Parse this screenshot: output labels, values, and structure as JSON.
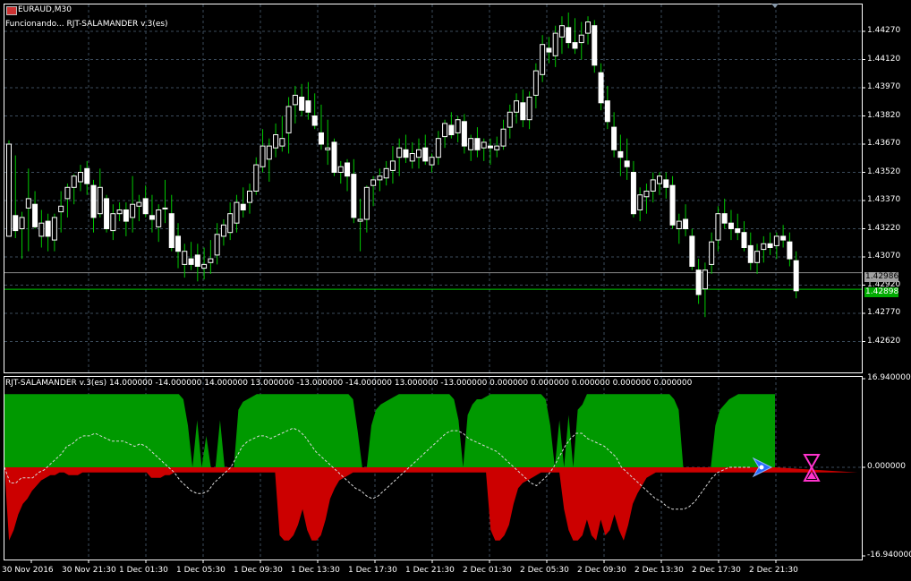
{
  "window": {
    "symbol_title": "EURAUD,M30",
    "status_text": "Funcionando... RJT-SALAMANDER v.3(es)"
  },
  "indicator": {
    "header": "RJT-SALAMANDER v.3(es) 14.000000 -14.000000 14.000000 13.000000 -13.000000 -14.000000 13.000000 -13.000000 0.000000 0.000000 0.000000 0.000000 0.000000"
  },
  "colors": {
    "background": "#000000",
    "grid": "#3c4c5c",
    "bull": "#ffffff",
    "bear": "#ffffff",
    "wick": "#00c800",
    "frame": "#ffffff",
    "green_fill": "#009900",
    "red_fill": "#cc0000",
    "dashed_line": "#d8d8d8",
    "bid_line": "#00cc00",
    "ask_line": "#888888",
    "bid_tag": "#00aa00",
    "ask_tag": "#a0a0a0"
  },
  "price_axis": {
    "labels": [
      "1.44270",
      "1.44120",
      "1.43970",
      "1.43820",
      "1.43670",
      "1.43520",
      "1.43370",
      "1.43220",
      "1.43070",
      "1.42920",
      "1.42770",
      "1.42620"
    ],
    "ask_tag": "1.42986",
    "bid_tag": "1.42898"
  },
  "indicator_axis": {
    "labels": [
      "16.940000",
      "0.000000",
      "-16.940000"
    ]
  },
  "time_axis": {
    "labels": [
      "30 Nov 2016",
      "30 Nov 21:30",
      "1 Dec 01:30",
      "1 Dec 05:30",
      "1 Dec 09:30",
      "1 Dec 13:30",
      "1 Dec 17:30",
      "1 Dec 21:30",
      "2 Dec 01:30",
      "2 Dec 05:30",
      "2 Dec 09:30",
      "2 Dec 13:30",
      "2 Dec 17:30",
      "2 Dec 21:30"
    ]
  },
  "chart_data": {
    "type": "candlestick",
    "symbol": "EURAUD",
    "timeframe": "M30",
    "candles": [
      [
        1.4318,
        1.4369,
        1.4318,
        1.4367
      ],
      [
        1.4329,
        1.4361,
        1.4317,
        1.4321
      ],
      [
        1.4322,
        1.4331,
        1.4306,
        1.4328
      ],
      [
        1.4333,
        1.4354,
        1.431,
        1.4338
      ],
      [
        1.4335,
        1.4342,
        1.4322,
        1.4323
      ],
      [
        1.4318,
        1.4332,
        1.4312,
        1.4325
      ],
      [
        1.4326,
        1.433,
        1.431,
        1.4318
      ],
      [
        1.4316,
        1.433,
        1.431,
        1.4328
      ],
      [
        1.4331,
        1.4342,
        1.432,
        1.4334
      ],
      [
        1.4338,
        1.4346,
        1.4328,
        1.4344
      ],
      [
        1.4344,
        1.4351,
        1.4335,
        1.435
      ],
      [
        1.4347,
        1.4356,
        1.4342,
        1.4352
      ],
      [
        1.4354,
        1.4358,
        1.434,
        1.4346
      ],
      [
        1.4345,
        1.4348,
        1.432,
        1.4328
      ],
      [
        1.433,
        1.4354,
        1.4328,
        1.4344
      ],
      [
        1.4338,
        1.434,
        1.432,
        1.4322
      ],
      [
        1.4321,
        1.4335,
        1.4316,
        1.433
      ],
      [
        1.433,
        1.4336,
        1.4326,
        1.4332
      ],
      [
        1.4332,
        1.4336,
        1.4318,
        1.4326
      ],
      [
        1.4328,
        1.435,
        1.432,
        1.4335
      ],
      [
        1.4334,
        1.434,
        1.4326,
        1.4336
      ],
      [
        1.4338,
        1.4345,
        1.4328,
        1.433
      ],
      [
        1.4329,
        1.434,
        1.432,
        1.4327
      ],
      [
        1.4323,
        1.4335,
        1.4315,
        1.4332
      ],
      [
        1.4333,
        1.4348,
        1.4325,
        1.4333
      ],
      [
        1.433,
        1.434,
        1.431,
        1.4312
      ],
      [
        1.4318,
        1.4325,
        1.4301,
        1.431
      ],
      [
        1.4303,
        1.4314,
        1.4296,
        1.431
      ],
      [
        1.4306,
        1.4315,
        1.43,
        1.4303
      ],
      [
        1.4308,
        1.4314,
        1.4294,
        1.4302
      ],
      [
        1.4301,
        1.4312,
        1.4295,
        1.4303
      ],
      [
        1.4304,
        1.4316,
        1.4298,
        1.4306
      ],
      [
        1.4308,
        1.4325,
        1.4303,
        1.4319
      ],
      [
        1.4318,
        1.4327,
        1.4313,
        1.4324
      ],
      [
        1.432,
        1.4336,
        1.4316,
        1.433
      ],
      [
        1.4325,
        1.434,
        1.432,
        1.4336
      ],
      [
        1.4335,
        1.4344,
        1.4328,
        1.4332
      ],
      [
        1.4336,
        1.4346,
        1.433,
        1.4342
      ],
      [
        1.4342,
        1.436,
        1.434,
        1.4356
      ],
      [
        1.4355,
        1.4375,
        1.4352,
        1.4366
      ],
      [
        1.4359,
        1.437,
        1.4347,
        1.4366
      ],
      [
        1.4365,
        1.4378,
        1.436,
        1.4372
      ],
      [
        1.4366,
        1.4382,
        1.4363,
        1.437
      ],
      [
        1.4373,
        1.4392,
        1.4362,
        1.4387
      ],
      [
        1.4388,
        1.4398,
        1.4378,
        1.4393
      ],
      [
        1.4392,
        1.4399,
        1.4382,
        1.4385
      ],
      [
        1.439,
        1.44,
        1.438,
        1.4384
      ],
      [
        1.4382,
        1.4394,
        1.4375,
        1.4377
      ],
      [
        1.4373,
        1.4388,
        1.4364,
        1.4367
      ],
      [
        1.4364,
        1.438,
        1.4356,
        1.4365
      ],
      [
        1.4368,
        1.437,
        1.435,
        1.4352
      ],
      [
        1.4352,
        1.4358,
        1.4346,
        1.4355
      ],
      [
        1.4357,
        1.4359,
        1.4342,
        1.435
      ],
      [
        1.4351,
        1.4359,
        1.4325,
        1.4328
      ],
      [
        1.4326,
        1.4338,
        1.431,
        1.4327
      ],
      [
        1.4327,
        1.4345,
        1.432,
        1.4344
      ],
      [
        1.4345,
        1.435,
        1.4334,
        1.4348
      ],
      [
        1.4348,
        1.4354,
        1.4342,
        1.435
      ],
      [
        1.4349,
        1.4358,
        1.4345,
        1.4354
      ],
      [
        1.4353,
        1.4366,
        1.4346,
        1.4358
      ],
      [
        1.436,
        1.437,
        1.435,
        1.4365
      ],
      [
        1.4364,
        1.4372,
        1.4357,
        1.436
      ],
      [
        1.4358,
        1.4368,
        1.4354,
        1.4362
      ],
      [
        1.436,
        1.437,
        1.4354,
        1.4364
      ],
      [
        1.4365,
        1.4372,
        1.4356,
        1.4358
      ],
      [
        1.4356,
        1.4362,
        1.4352,
        1.436
      ],
      [
        1.436,
        1.4374,
        1.4356,
        1.437
      ],
      [
        1.4371,
        1.438,
        1.4365,
        1.4378
      ],
      [
        1.4377,
        1.4384,
        1.437,
        1.4372
      ],
      [
        1.4373,
        1.4382,
        1.4368,
        1.438
      ],
      [
        1.4379,
        1.4383,
        1.4362,
        1.4366
      ],
      [
        1.4364,
        1.4372,
        1.4358,
        1.437
      ],
      [
        1.437,
        1.4376,
        1.436,
        1.4364
      ],
      [
        1.4365,
        1.437,
        1.4358,
        1.4368
      ],
      [
        1.4366,
        1.437,
        1.4356,
        1.4365
      ],
      [
        1.4364,
        1.4371,
        1.436,
        1.4366
      ],
      [
        1.4366,
        1.438,
        1.4364,
        1.4375
      ],
      [
        1.4376,
        1.4388,
        1.437,
        1.4384
      ],
      [
        1.4384,
        1.4394,
        1.4378,
        1.439
      ],
      [
        1.4389,
        1.4396,
        1.4376,
        1.438
      ],
      [
        1.438,
        1.4395,
        1.4375,
        1.4392
      ],
      [
        1.4393,
        1.441,
        1.4386,
        1.4406
      ],
      [
        1.4404,
        1.4425,
        1.44,
        1.442
      ],
      [
        1.4418,
        1.4424,
        1.441,
        1.4416
      ],
      [
        1.4414,
        1.443,
        1.4408,
        1.4426
      ],
      [
        1.4424,
        1.4435,
        1.4415,
        1.443
      ],
      [
        1.4429,
        1.4437,
        1.4418,
        1.4421
      ],
      [
        1.4421,
        1.4434,
        1.4415,
        1.4418
      ],
      [
        1.4421,
        1.4432,
        1.4412,
        1.4425
      ],
      [
        1.4426,
        1.4435,
        1.442,
        1.4432
      ],
      [
        1.443,
        1.4433,
        1.4405,
        1.4409
      ],
      [
        1.4405,
        1.441,
        1.4385,
        1.4389
      ],
      [
        1.439,
        1.4398,
        1.4375,
        1.4379
      ],
      [
        1.4376,
        1.4384,
        1.436,
        1.4364
      ],
      [
        1.4363,
        1.4372,
        1.435,
        1.436
      ],
      [
        1.4358,
        1.437,
        1.4348,
        1.4355
      ],
      [
        1.4352,
        1.4358,
        1.4328,
        1.433
      ],
      [
        1.4332,
        1.4344,
        1.4326,
        1.434
      ],
      [
        1.4339,
        1.4346,
        1.433,
        1.4342
      ],
      [
        1.4342,
        1.4352,
        1.4336,
        1.4348
      ],
      [
        1.4346,
        1.4352,
        1.434,
        1.435
      ],
      [
        1.4348,
        1.4352,
        1.4338,
        1.4344
      ],
      [
        1.4345,
        1.435,
        1.4322,
        1.4324
      ],
      [
        1.4322,
        1.433,
        1.4314,
        1.4326
      ],
      [
        1.4327,
        1.4335,
        1.4318,
        1.4322
      ],
      [
        1.4318,
        1.4322,
        1.43,
        1.4302
      ],
      [
        1.43,
        1.4306,
        1.4282,
        1.4287
      ],
      [
        1.429,
        1.4304,
        1.4275,
        1.43
      ],
      [
        1.4303,
        1.432,
        1.4298,
        1.4315
      ],
      [
        1.4316,
        1.4334,
        1.431,
        1.433
      ],
      [
        1.433,
        1.4338,
        1.4322,
        1.4325
      ],
      [
        1.4325,
        1.4332,
        1.4316,
        1.4322
      ],
      [
        1.4322,
        1.433,
        1.4316,
        1.432
      ],
      [
        1.432,
        1.4326,
        1.431,
        1.4312
      ],
      [
        1.4313,
        1.432,
        1.43,
        1.4304
      ],
      [
        1.4304,
        1.4314,
        1.4298,
        1.431
      ],
      [
        1.4311,
        1.4318,
        1.4304,
        1.4314
      ],
      [
        1.4314,
        1.432,
        1.4308,
        1.4312
      ],
      [
        1.4313,
        1.432,
        1.4306,
        1.4318
      ],
      [
        1.4318,
        1.4324,
        1.4312,
        1.4316
      ],
      [
        1.4315,
        1.432,
        1.4302,
        1.4306
      ],
      [
        1.4305,
        1.431,
        1.4285,
        1.4289
      ]
    ],
    "indicator_panel": {
      "name": "RJT-SALAMANDER v.3(es)",
      "ylim": [
        -16.94,
        16.94
      ],
      "series": [
        {
          "values": [
            14,
            14,
            14,
            14,
            14,
            14,
            14,
            14,
            14,
            14,
            14,
            14,
            14,
            14,
            14,
            14,
            14,
            14,
            14,
            14,
            14,
            14,
            14,
            14,
            14,
            14,
            14,
            14,
            14,
            14,
            14,
            14,
            14,
            14,
            14,
            14,
            14,
            14,
            14,
            13,
            8,
            0,
            9,
            0,
            6,
            0,
            0,
            9,
            0,
            0,
            0,
            11,
            12.5,
            13,
            13.5,
            14,
            14,
            14,
            14,
            14,
            14,
            14,
            14,
            14,
            14,
            14,
            14,
            14,
            14,
            14,
            14,
            14,
            14,
            14,
            14,
            14,
            13,
            7,
            0,
            0,
            8,
            11,
            12,
            12.5,
            13,
            13.5,
            14,
            14,
            14,
            14,
            14,
            14,
            14,
            14,
            14,
            14,
            14,
            14,
            13,
            9,
            0,
            10,
            12,
            13,
            13,
            13.5,
            14,
            14,
            14,
            14,
            14,
            14,
            14,
            14,
            14,
            14,
            14,
            14,
            13,
            8,
            0,
            9,
            0,
            10,
            0,
            11,
            12,
            14,
            14,
            14,
            14,
            14,
            14,
            14,
            14,
            14,
            14,
            14,
            14,
            14,
            14,
            14,
            14,
            14,
            14,
            14,
            13,
            11,
            0,
            0,
            0,
            0,
            0,
            0,
            0,
            8,
            11,
            12,
            13,
            13.5,
            14,
            14,
            14,
            14,
            14,
            14,
            14,
            14,
            14
          ]
        },
        {
          "values": [
            0,
            -14,
            -12,
            -9,
            -7,
            -6,
            -4.5,
            -3.5,
            -2.5,
            -2,
            -1.5,
            -1.5,
            -1,
            -1,
            -1.5,
            -1.5,
            -1.5,
            -1,
            -1,
            -1,
            -1,
            -1,
            -1,
            -1,
            -1,
            -1,
            -1,
            -1,
            -1,
            -1,
            -1,
            -1,
            -2,
            -2,
            -2,
            -1.5,
            -1.5,
            -1,
            -1,
            -1,
            -1,
            -1,
            -1,
            -1,
            -1,
            -1,
            -1,
            -1,
            -1,
            -1,
            -1,
            -1,
            -1,
            -1,
            -1,
            -1,
            -1,
            -1,
            -1,
            -1,
            -13,
            -14,
            -14,
            -13,
            -11,
            -8,
            -12,
            -14,
            -14,
            -13,
            -10,
            -6,
            -4,
            -2.5,
            -2,
            -1.5,
            -1,
            -1,
            -1,
            -1,
            -1,
            -1,
            -1,
            -1,
            -1,
            -1,
            -1,
            -1,
            -1,
            -1,
            -1,
            -1,
            -1,
            -1,
            -1,
            -1,
            -1,
            -1,
            -1,
            -1,
            -1,
            -1,
            -1,
            -1,
            -1,
            -1,
            -12,
            -14,
            -14,
            -13,
            -11,
            -7,
            -4,
            -3,
            -2.5,
            -2,
            -1.5,
            -1,
            -1,
            -1,
            -1,
            -1,
            -8,
            -12,
            -14,
            -14,
            -13,
            -10,
            -13,
            -14,
            -10,
            -13,
            -12,
            -9,
            -12,
            -14,
            -11,
            -7,
            -5,
            -3.5,
            -2,
            -1.5,
            -1,
            -1,
            -1,
            -1,
            -1,
            -1,
            -1,
            -1,
            -1,
            -1,
            -1,
            -1,
            -1,
            -1,
            -1,
            -1,
            -1,
            -1,
            -1,
            -1,
            -1,
            -1,
            -1,
            -1,
            -1,
            -1,
            -1,
            -1,
            -1,
            -1,
            -1,
            -1,
            -1,
            -1,
            -1,
            -1,
            -1,
            -1,
            -1,
            -1,
            -1,
            -1,
            -1,
            -1,
            -1
          ]
        },
        {
          "values": [
            0,
            -3,
            -3,
            -2,
            -2,
            -2,
            -1,
            -0.5,
            0.5,
            1.5,
            2.5,
            4,
            4.5,
            5.5,
            6,
            6,
            6.5,
            6,
            5.5,
            5,
            5,
            5,
            4.5,
            4,
            4.5,
            4,
            3,
            2,
            1,
            0,
            -1,
            -2.5,
            -3.5,
            -4.5,
            -5,
            -5,
            -4.5,
            -3,
            -2,
            -1,
            0,
            2,
            4,
            5,
            5.5,
            6,
            6,
            5.5,
            6,
            6.5,
            7,
            7.5,
            7,
            6,
            4.5,
            3,
            2,
            1,
            0,
            -1,
            -2,
            -3,
            -4,
            -4.5,
            -5.5,
            -6,
            -5.5,
            -4.5,
            -3.5,
            -2.5,
            -1.5,
            -0.5,
            0.5,
            1.5,
            2.5,
            3.5,
            4.5,
            5.5,
            6.5,
            7,
            7,
            6.5,
            5.5,
            5,
            4.5,
            4,
            3.5,
            3,
            2,
            1,
            0,
            -1,
            -2,
            -3,
            -3.5,
            -2.5,
            -1.5,
            0,
            2,
            4,
            5.5,
            6.5,
            6.5,
            5.5,
            5,
            4.5,
            4,
            3,
            2,
            0,
            -1,
            -2,
            -3,
            -4,
            -5,
            -6,
            -6.5,
            -7.5,
            -8,
            -8,
            -8,
            -7.5,
            -6.5,
            -5,
            -3.5,
            -2,
            -1,
            -0.5,
            0,
            0,
            0,
            0,
            0
          ]
        }
      ]
    }
  }
}
